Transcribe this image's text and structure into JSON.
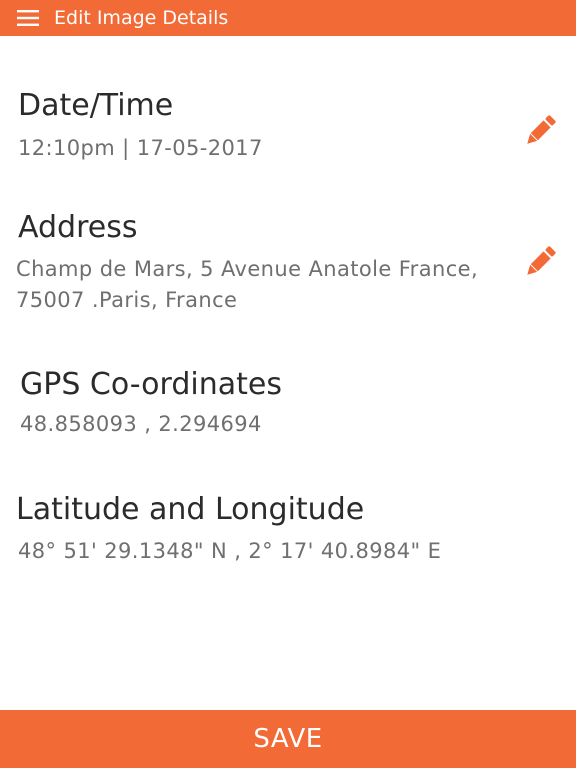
{
  "header": {
    "title": "Edit Image Details",
    "menu_icon": "hamburger-menu-icon",
    "background": "#f26a36"
  },
  "datetime": {
    "heading": "Date/Time",
    "value": "12:10pm | 17-05-2017",
    "edit_icon": "pencil-icon"
  },
  "address": {
    "heading": "Address",
    "line1": "Champ de Mars, 5 Avenue Anatole France,",
    "line2": "75007 .Paris, France",
    "edit_icon": "pencil-icon"
  },
  "gps": {
    "heading": "GPS Co-ordinates",
    "value": "48.858093 ,  2.294694"
  },
  "latlong": {
    "heading": "Latitude and Longitude",
    "value": "48° 51' 29.1348\" N , 2° 17' 40.8984\" E"
  },
  "footer": {
    "save_label": "SAVE"
  },
  "colors": {
    "accent": "#f26a36",
    "heading_text": "#2b2b2b",
    "value_text": "#6f6f6f"
  }
}
